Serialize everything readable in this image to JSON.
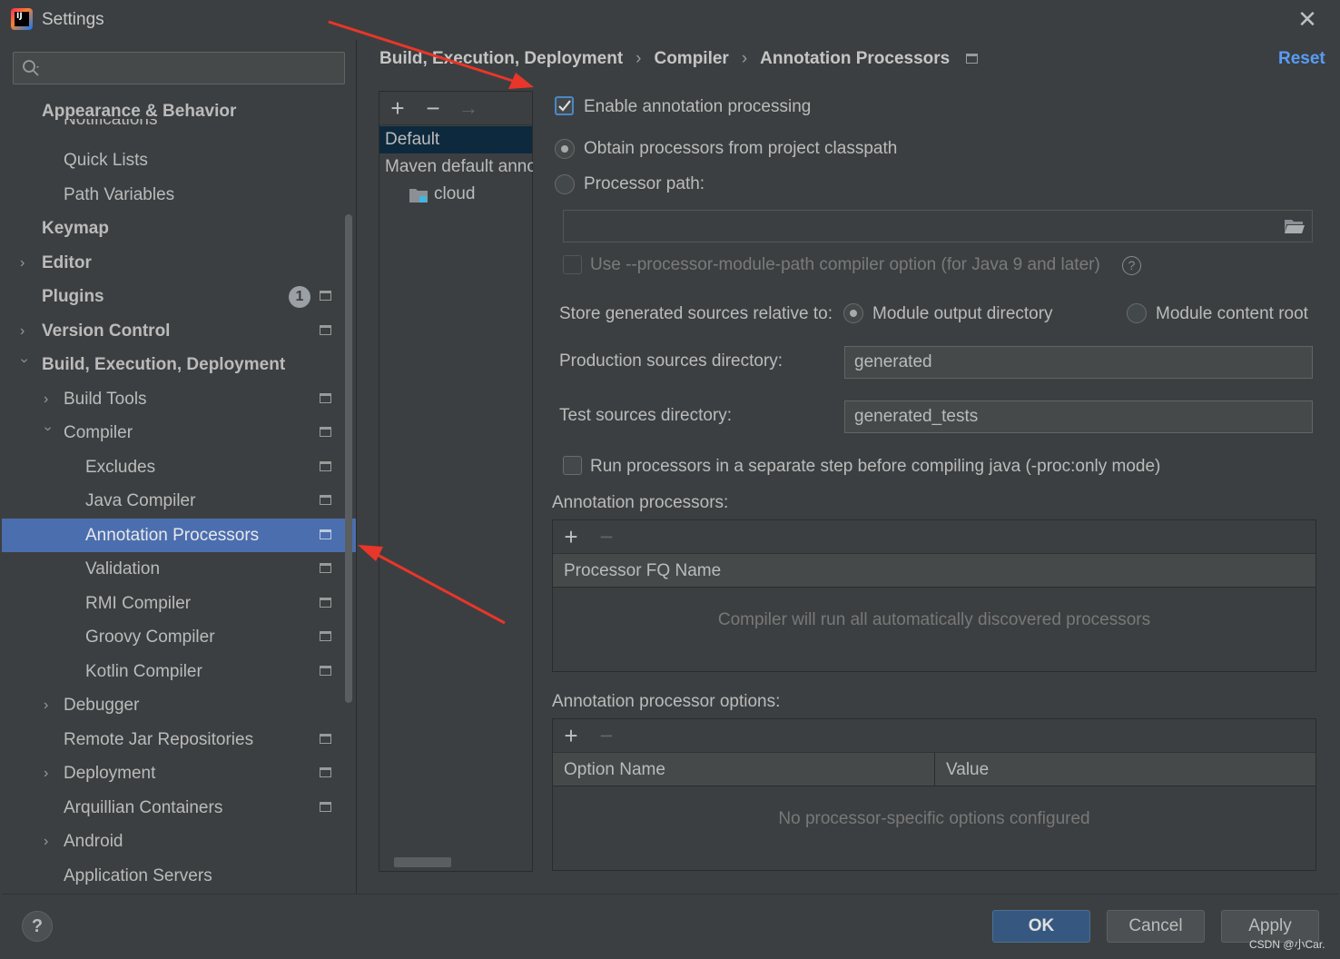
{
  "window": {
    "title": "Settings",
    "close_glyph": "✕",
    "app_icon_text": "IJ"
  },
  "sidebar": {
    "search_placeholder": "",
    "items": [
      {
        "label": "Appearance & Behavior",
        "bold": true
      },
      {
        "label": "Notifications"
      },
      {
        "label": "Quick Lists"
      },
      {
        "label": "Path Variables"
      },
      {
        "label": "Keymap",
        "bold": true
      },
      {
        "label": "Editor",
        "bold": true
      },
      {
        "label": "Plugins",
        "bold": true,
        "badge": "1"
      },
      {
        "label": "Version Control",
        "bold": true
      },
      {
        "label": "Build, Execution, Deployment",
        "bold": true
      },
      {
        "label": "Build Tools"
      },
      {
        "label": "Compiler"
      },
      {
        "label": "Excludes"
      },
      {
        "label": "Java Compiler"
      },
      {
        "label": "Annotation Processors",
        "selected": true
      },
      {
        "label": "Validation"
      },
      {
        "label": "RMI Compiler"
      },
      {
        "label": "Groovy Compiler"
      },
      {
        "label": "Kotlin Compiler"
      },
      {
        "label": "Debugger"
      },
      {
        "label": "Remote Jar Repositories"
      },
      {
        "label": "Deployment"
      },
      {
        "label": "Arquillian Containers"
      },
      {
        "label": "Android"
      },
      {
        "label": "Application Servers"
      }
    ]
  },
  "breadcrumb": {
    "parts": [
      "Build, Execution, Deployment",
      "Compiler",
      "Annotation Processors"
    ],
    "separator": "›",
    "reset": "Reset"
  },
  "profiles": {
    "add": "+",
    "remove": "−",
    "move": "→",
    "items": [
      "Default",
      "Maven default annotation processors profile",
      "cloud"
    ]
  },
  "options": {
    "enable_processing": "Enable annotation processing",
    "enable_processing_checked": true,
    "obtain_from_classpath": "Obtain processors from project classpath",
    "processor_path": "Processor path:",
    "processor_path_value": "",
    "module_path_option": "Use --processor-module-path compiler option (for Java 9 and later)",
    "help_glyph": "?",
    "store_relative_label": "Store generated sources relative to:",
    "module_output_dir": "Module output directory",
    "module_content_root": "Module content root",
    "production_dir_label": "Production sources directory:",
    "production_dir_value": "generated",
    "test_dir_label": "Test sources directory:",
    "test_dir_value": "generated_tests",
    "separate_step": "Run processors in a separate step before compiling java (-proc:only mode)"
  },
  "processors_table": {
    "title": "Annotation processors:",
    "add": "+",
    "remove": "−",
    "column": "Processor FQ Name",
    "empty": "Compiler will run all automatically discovered processors"
  },
  "options_table": {
    "title": "Annotation processor options:",
    "add": "+",
    "remove": "−",
    "col_name": "Option Name",
    "col_value": "Value",
    "empty": "No processor-specific options configured"
  },
  "footer": {
    "help": "?",
    "ok": "OK",
    "cancel": "Cancel",
    "apply": "Apply",
    "watermark": "CSDN @小Car."
  },
  "colors": {
    "background": "#3c3f41",
    "selection": "#4b6eaf",
    "link": "#589df6",
    "primary_button": "#365880",
    "annotation_arrow": "#e8362a"
  }
}
